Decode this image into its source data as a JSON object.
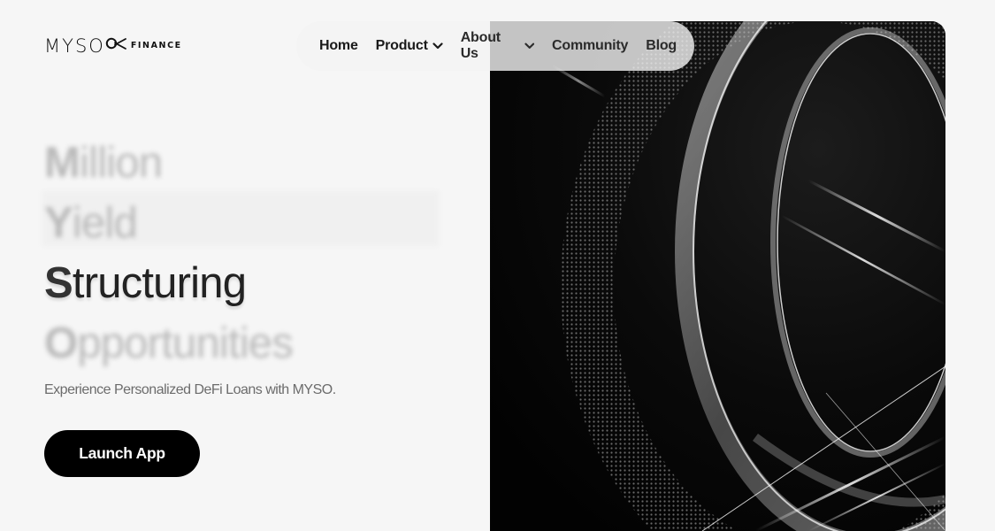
{
  "brand": {
    "name": "MYSO",
    "sub": "FINANCE"
  },
  "nav": {
    "items": [
      {
        "label": "Home"
      },
      {
        "label": "Product"
      },
      {
        "label": "About Us"
      },
      {
        "label": "Community"
      },
      {
        "label": "Blog"
      }
    ]
  },
  "hero": {
    "words": [
      {
        "cap": "M",
        "rest": "illion"
      },
      {
        "cap": "Y",
        "rest": "ield"
      },
      {
        "cap": "S",
        "rest": "tructuring"
      },
      {
        "cap": "O",
        "rest": "pportunities"
      }
    ],
    "tagline": "Experience Personalized DeFi Loans with MYSO.",
    "cta_label": "Launch App"
  }
}
